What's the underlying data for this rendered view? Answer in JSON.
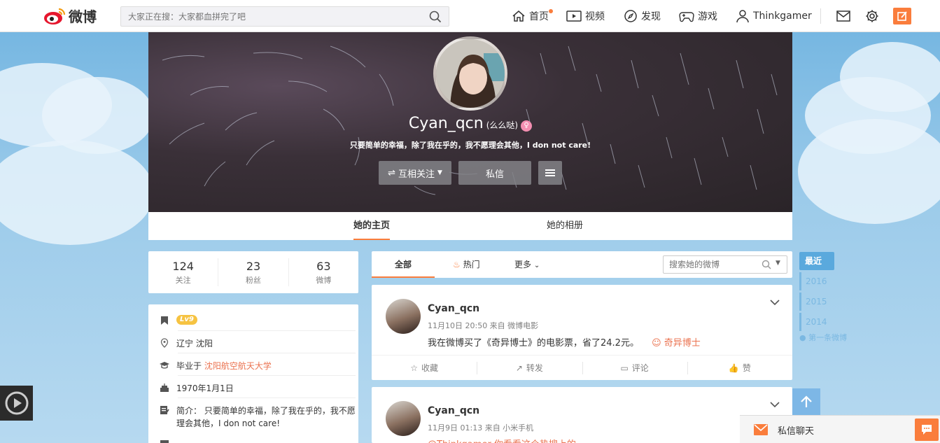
{
  "topnav": {
    "logo_text": "微博",
    "search_placeholder": "大家正在搜：大家都血拼完了吧",
    "items": [
      {
        "label": "首页",
        "icon": "home-icon"
      },
      {
        "label": "视频",
        "icon": "video-icon"
      },
      {
        "label": "发现",
        "icon": "compass-icon"
      },
      {
        "label": "游戏",
        "icon": "gamepad-icon"
      },
      {
        "label": "Thinkgamer",
        "icon": "user-icon"
      }
    ],
    "accent": "#fa7d3c"
  },
  "profile": {
    "name": "Cyan_qcn",
    "nickname": "(么么哒)",
    "bio": "只要简单的幸福，除了我在乎的，我不愿理会其他，I don not care!",
    "buttons": {
      "follow": "互相关注",
      "message": "私信"
    },
    "tabs": [
      "她的主页",
      "她的相册"
    ]
  },
  "stats": [
    {
      "num": "124",
      "label": "关注"
    },
    {
      "num": "23",
      "label": "粉丝"
    },
    {
      "num": "63",
      "label": "微博"
    }
  ],
  "info": {
    "level": "Lv9",
    "location": "辽宁 沈阳",
    "school_prefix": "毕业于 ",
    "school": "沈阳航空航天大学",
    "birthday": "1970年1月1日",
    "bio_prefix": "简介：",
    "bio": "只要简单的幸福，除了我在乎的，我不愿理会其他，I don not care!"
  },
  "feed": {
    "tabs": [
      "全部",
      "热门",
      "更多"
    ],
    "search_placeholder": "搜索她的微博",
    "posts": [
      {
        "name": "Cyan_qcn",
        "meta": "11月10日 20:50 来自 微博电影",
        "text": "我在微博买了《奇异博士》的电影票，省了24.2元。",
        "link": "奇异博士",
        "actions": [
          "收藏",
          "转发",
          "评论",
          "赞"
        ]
      },
      {
        "name": "Cyan_qcn",
        "meta": "11月9日 01:13 来自 小米手机",
        "text_partial": "@Thinkgamer   你看看这个热搜上的"
      }
    ]
  },
  "timeline": {
    "recent": "最近",
    "years": [
      "2016",
      "2015",
      "2014"
    ],
    "first": "第一条微博"
  },
  "chat": {
    "label": "私信聊天"
  }
}
